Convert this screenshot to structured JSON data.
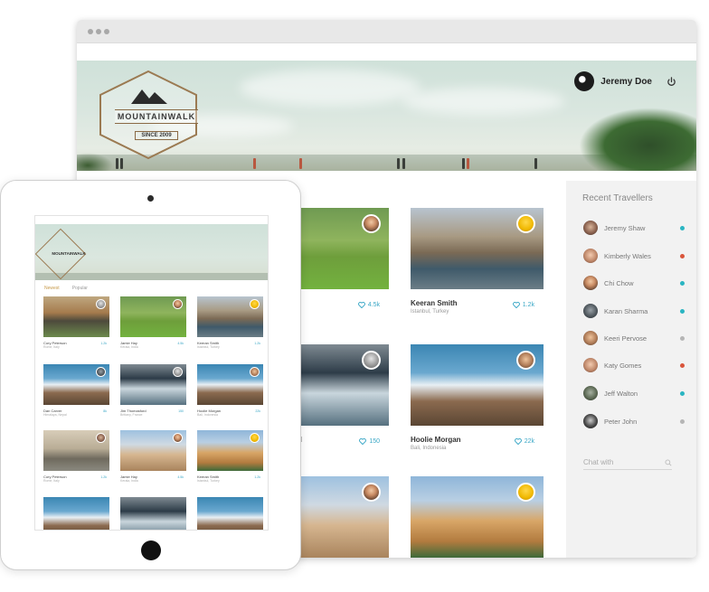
{
  "header": {
    "logo_text": "MOUNTAINWALK",
    "logo_since": "SINCE 2009",
    "user_name": "Jeremy Doe"
  },
  "cards": [
    {
      "name": "",
      "location": "",
      "likes": "4.5k"
    },
    {
      "name": "Keeran Smith",
      "location": "Istanbul, Turkey",
      "likes": "1.2k"
    },
    {
      "name": "d",
      "location": "",
      "likes": "150"
    },
    {
      "name": "Hoolie Morgan",
      "location": "Bali, Indonesia",
      "likes": "22k"
    },
    {
      "name": "",
      "location": "",
      "likes": ""
    },
    {
      "name": "",
      "location": "",
      "likes": ""
    }
  ],
  "sidebar": {
    "title": "Recent Travellers",
    "travellers": [
      {
        "name": "Jeremy Shaw",
        "status_color": "#2ab5c2"
      },
      {
        "name": "Kimberly Wales",
        "status_color": "#d9553b"
      },
      {
        "name": "Chi Chow",
        "status_color": "#2ab5c2"
      },
      {
        "name": "Karan Sharma",
        "status_color": "#2ab5c2"
      },
      {
        "name": "Keeri Pervose",
        "status_color": "#b5b5b5"
      },
      {
        "name": "Katy Gomes",
        "status_color": "#d9553b"
      },
      {
        "name": "Jeff Walton",
        "status_color": "#2ab5c2"
      },
      {
        "name": "Peter John",
        "status_color": "#b5b5b5"
      }
    ],
    "chat_label": "Chat with"
  },
  "tablet": {
    "logo_text": "MOUNTAINWALK",
    "tabs": [
      "Newest",
      "Popular"
    ],
    "cards": [
      {
        "name": "Cory Peterson",
        "location": "Rome, Italy",
        "likes": "1.2k"
      },
      {
        "name": "Jamie Hay",
        "location": "Kerala, India",
        "likes": "4.5k"
      },
      {
        "name": "Keeran Smith",
        "location": "Istanbul, Turkey",
        "likes": "1.2k"
      },
      {
        "name": "Dan Carver",
        "location": "Himalaya, Nepal",
        "likes": "8k"
      },
      {
        "name": "Jim Thomasford",
        "location": "Brittany, France",
        "likes": "150"
      },
      {
        "name": "Hoolie Morgan",
        "location": "Bali, Indonesia",
        "likes": "22k"
      },
      {
        "name": "Cory Peterson",
        "location": "Rome, Italy",
        "likes": "1.2k"
      },
      {
        "name": "Jamie Hay",
        "location": "Kerala, India",
        "likes": "4.5k"
      },
      {
        "name": "Keeran Smith",
        "location": "Istanbul, Turkey",
        "likes": "1.2k"
      }
    ]
  }
}
